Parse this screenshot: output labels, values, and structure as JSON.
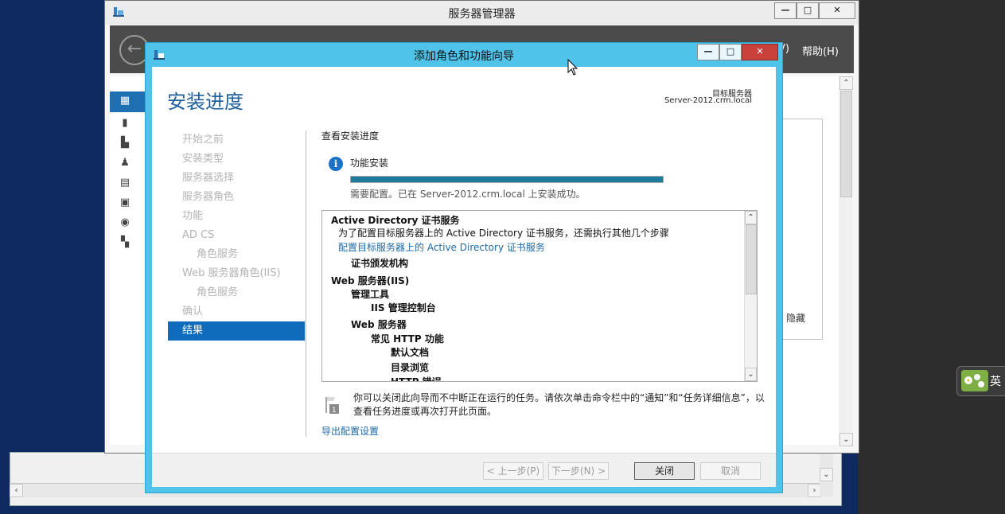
{
  "server_manager": {
    "title": "服务器管理器",
    "menu_v": "V)",
    "menu_help": "帮助(H)",
    "hide_label": "隐藏"
  },
  "wizard": {
    "title": "添加角色和功能向导",
    "page_title": "安装进度",
    "target_server_label": "目标服务器",
    "target_server_value": "Server-2012.crm.local",
    "nav": [
      {
        "label": "开始之前"
      },
      {
        "label": "安装类型"
      },
      {
        "label": "服务器选择"
      },
      {
        "label": "服务器角色"
      },
      {
        "label": "功能"
      },
      {
        "label": "AD CS"
      },
      {
        "label": "角色服务"
      },
      {
        "label": "Web 服务器角色(IIS)"
      },
      {
        "label": "角色服务"
      },
      {
        "label": "确认"
      },
      {
        "label": "结果"
      }
    ],
    "view_progress_label": "查看安装进度",
    "feature_install_label": "功能安装",
    "progress_fraction": 1.0,
    "status_text": "需要配置。已在 Server-2012.crm.local 上安装成功。",
    "results": [
      {
        "text": "Active Directory 证书服务",
        "style": "bold",
        "indent": 0
      },
      {
        "text": "为了配置目标服务器上的 Active Directory 证书服务，还需执行其他几个步骤",
        "style": "normal",
        "indent": 1
      },
      {
        "text": "配置目标服务器上的 Active Directory 证书服务",
        "style": "link",
        "indent": 1
      },
      {
        "text": "证书颁发机构",
        "style": "bold",
        "indent": 2
      },
      {
        "text": "Web 服务器(IIS)",
        "style": "bold",
        "indent": 0
      },
      {
        "text": "管理工具",
        "style": "bold",
        "indent": 2
      },
      {
        "text": "IIS 管理控制台",
        "style": "bold",
        "indent": 3
      },
      {
        "text": "Web 服务器",
        "style": "bold",
        "indent": 2
      },
      {
        "text": "常见 HTTP 功能",
        "style": "bold",
        "indent": 3
      },
      {
        "text": "默认文档",
        "style": "bold",
        "indent": 4
      },
      {
        "text": "目录浏览",
        "style": "bold",
        "indent": 4
      },
      {
        "text": "HTTP 错误",
        "style": "bold",
        "indent": 4
      }
    ],
    "note_text": "你可以关闭此向导而不中断正在运行的任务。请依次单击命令栏中的“通知”和“任务详细信息”，以查看任务进度或再次打开此页面。",
    "export_link": "导出配置设置",
    "buttons": {
      "prev": "< 上一步(P)",
      "next": "下一步(N) >",
      "close": "关闭",
      "cancel": "取消"
    }
  },
  "tray": {
    "ime_label": "英"
  },
  "colors": {
    "wizard_frame": "#4fc3ea",
    "nav_selected": "#0f6cbd",
    "page_title": "#1f5f9e",
    "link": "#1d6aa8",
    "progress_fill": "#1e7b9c"
  }
}
